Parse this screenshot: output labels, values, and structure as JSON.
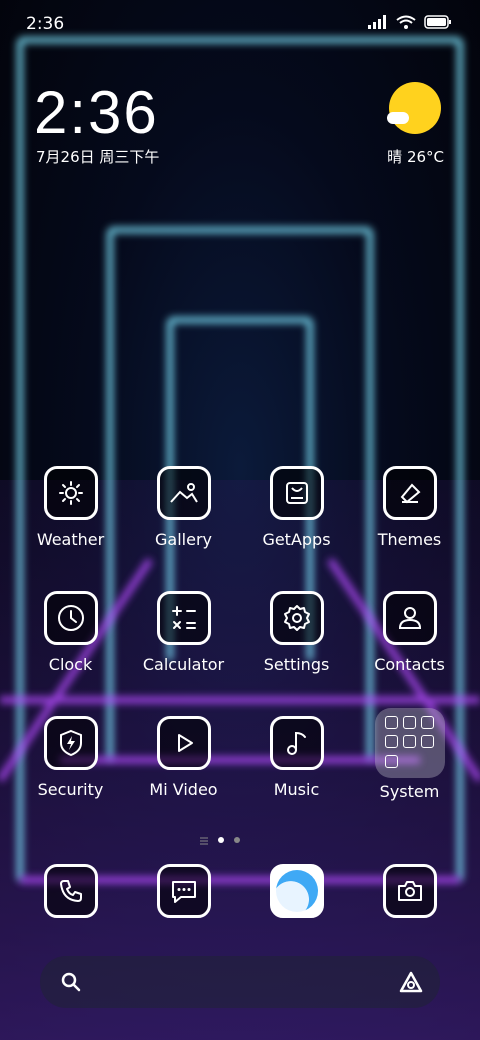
{
  "status_bar": {
    "time": "2:36",
    "icons": [
      "signal-icon",
      "wifi-icon",
      "battery-icon"
    ]
  },
  "clock_widget": {
    "time": "2:36",
    "date": "7月26日 周三下午"
  },
  "weather_widget": {
    "condition": "晴",
    "temperature": "26°C",
    "icon": "sun-cloud-icon"
  },
  "apps": [
    {
      "label": "Weather",
      "icon": "sun-icon"
    },
    {
      "label": "Gallery",
      "icon": "picture-icon"
    },
    {
      "label": "GetApps",
      "icon": "store-icon"
    },
    {
      "label": "Themes",
      "icon": "brush-icon"
    },
    {
      "label": "Clock",
      "icon": "clock-icon"
    },
    {
      "label": "Calculator",
      "icon": "calculator-icon"
    },
    {
      "label": "Settings",
      "icon": "gear-icon"
    },
    {
      "label": "Contacts",
      "icon": "person-icon"
    },
    {
      "label": "Security",
      "icon": "shield-bolt-icon"
    },
    {
      "label": "Mi Video",
      "icon": "play-icon"
    },
    {
      "label": "Music",
      "icon": "music-note-icon"
    },
    {
      "label": "System",
      "icon": "folder-icon"
    }
  ],
  "page_indicator": {
    "pages": 2,
    "current": 1
  },
  "dock": [
    {
      "name": "phone",
      "icon": "phone-icon"
    },
    {
      "name": "messages",
      "icon": "message-icon"
    },
    {
      "name": "browser",
      "icon": "browser-icon"
    },
    {
      "name": "camera",
      "icon": "camera-icon"
    }
  ],
  "search_bar": {
    "left_icon": "search-icon",
    "right_icon": "assistant-icon"
  },
  "colors": {
    "sun": "#ffd21e",
    "browser_blue": "#3fa9f5"
  }
}
